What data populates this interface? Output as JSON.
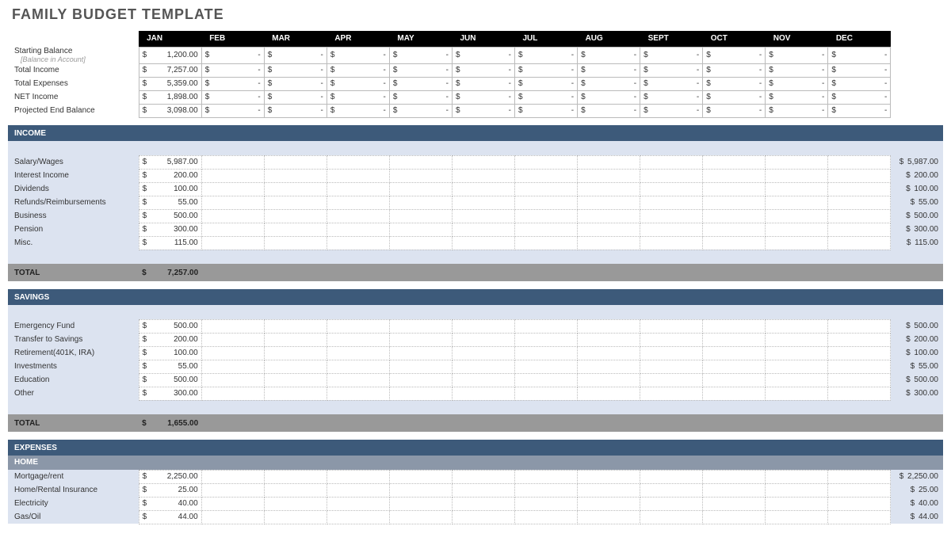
{
  "title": "FAMILY BUDGET TEMPLATE",
  "months": [
    "JAN",
    "FEB",
    "MAR",
    "APR",
    "MAY",
    "JUN",
    "JUL",
    "AUG",
    "SEPT",
    "OCT",
    "NOV",
    "DEC"
  ],
  "summary_note": "[Balance in Account]",
  "summary": [
    {
      "label": "Starting Balance",
      "jan": "1,200.00"
    },
    {
      "label": "Total Income",
      "jan": "7,257.00"
    },
    {
      "label": "Total Expenses",
      "jan": "5,359.00"
    },
    {
      "label": "NET Income",
      "jan": "1,898.00"
    },
    {
      "label": "Projected End Balance",
      "jan": "3,098.00"
    }
  ],
  "sections": [
    {
      "name": "INCOME",
      "items": [
        {
          "label": "Salary/Wages",
          "jan": "5,987.00",
          "total": "5,987.00"
        },
        {
          "label": "Interest Income",
          "jan": "200.00",
          "total": "200.00"
        },
        {
          "label": "Dividends",
          "jan": "100.00",
          "total": "100.00"
        },
        {
          "label": "Refunds/Reimbursements",
          "jan": "55.00",
          "total": "55.00"
        },
        {
          "label": "Business",
          "jan": "500.00",
          "total": "500.00"
        },
        {
          "label": "Pension",
          "jan": "300.00",
          "total": "300.00"
        },
        {
          "label": "Misc.",
          "jan": "115.00",
          "total": "115.00"
        }
      ],
      "total": "7,257.00"
    },
    {
      "name": "SAVINGS",
      "items": [
        {
          "label": "Emergency Fund",
          "jan": "500.00",
          "total": "500.00"
        },
        {
          "label": "Transfer to Savings",
          "jan": "200.00",
          "total": "200.00"
        },
        {
          "label": "Retirement(401K, IRA)",
          "jan": "100.00",
          "total": "100.00"
        },
        {
          "label": "Investments",
          "jan": "55.00",
          "total": "55.00"
        },
        {
          "label": "Education",
          "jan": "500.00",
          "total": "500.00"
        },
        {
          "label": "Other",
          "jan": "300.00",
          "total": "300.00"
        }
      ],
      "total": "1,655.00"
    },
    {
      "name": "EXPENSES",
      "sub": "HOME",
      "items": [
        {
          "label": "Mortgage/rent",
          "jan": "2,250.00",
          "total": "2,250.00"
        },
        {
          "label": "Home/Rental Insurance",
          "jan": "25.00",
          "total": "25.00"
        },
        {
          "label": "Electricity",
          "jan": "40.00",
          "total": "40.00"
        },
        {
          "label": "Gas/Oil",
          "jan": "44.00",
          "total": "44.00"
        }
      ]
    }
  ],
  "labels": {
    "total": "TOTAL",
    "dollar": "$",
    "dash": "-"
  }
}
